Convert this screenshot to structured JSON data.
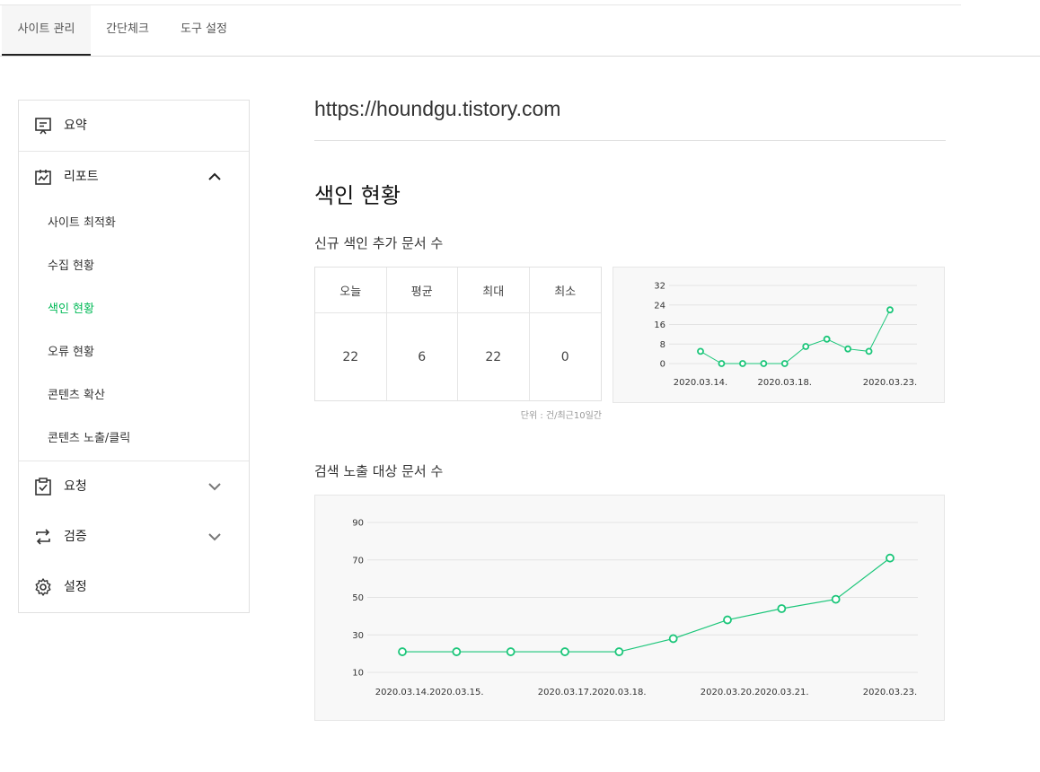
{
  "tabs": [
    {
      "label": "사이트 관리",
      "active": true
    },
    {
      "label": "간단체크",
      "active": false
    },
    {
      "label": "도구 설정",
      "active": false
    }
  ],
  "sidebar": {
    "summary": "요약",
    "report": "리포트",
    "report_items": [
      "사이트 최적화",
      "수집 현황",
      "색인 현황",
      "오류 현황",
      "콘텐츠 확산",
      "콘텐츠 노출/클릭"
    ],
    "active_item": "색인 현황",
    "request": "요청",
    "verify": "검증",
    "settings": "설정"
  },
  "site_url": "https://houndgu.tistory.com",
  "page_title": "색인 현황",
  "section1": {
    "title": "신규 색인 추가 문서 수",
    "headers": [
      "오늘",
      "평균",
      "최대",
      "최소"
    ],
    "values": [
      "22",
      "6",
      "22",
      "0"
    ],
    "unit": "단위 : 건/최근10일간"
  },
  "section2": {
    "title": "검색 노출 대상 문서 수"
  },
  "colors": {
    "accent": "#00b956",
    "line": "#1cc67a"
  },
  "icons": [
    "summary-icon",
    "report-icon",
    "chevron-up-icon",
    "request-icon",
    "chevron-down-icon",
    "verify-icon",
    "gear-icon"
  ],
  "chart_data": [
    {
      "type": "line",
      "x": [
        "2020.03.14.",
        "2020.03.15.",
        "2020.03.16.",
        "2020.03.17.",
        "2020.03.18.",
        "2020.03.19.",
        "2020.03.20.",
        "2020.03.21.",
        "2020.03.22.",
        "2020.03.23."
      ],
      "xtick_labels": [
        "2020.03.14.",
        "2020.03.18.",
        "2020.03.23."
      ],
      "values": [
        5,
        0,
        0,
        0,
        0,
        7,
        10,
        6,
        5,
        22
      ],
      "yticks": [
        0,
        8,
        16,
        24,
        32
      ],
      "ylim": [
        0,
        32
      ],
      "grid": true
    },
    {
      "type": "line",
      "x": [
        "2020.03.14.",
        "2020.03.15.",
        "2020.03.16.",
        "2020.03.17.",
        "2020.03.18.",
        "2020.03.19.",
        "2020.03.20.",
        "2020.03.21.",
        "2020.03.22.",
        "2020.03.23."
      ],
      "xtick_labels": [
        "2020.03.14.",
        "2020.03.15.",
        "2020.03.17.",
        "2020.03.18.",
        "2020.03.20.",
        "2020.03.21.",
        "2020.03.23."
      ],
      "values": [
        21,
        21,
        21,
        21,
        21,
        28,
        38,
        44,
        49,
        71
      ],
      "yticks": [
        10,
        30,
        50,
        70,
        90
      ],
      "ylim": [
        10,
        90
      ],
      "grid": true
    }
  ]
}
